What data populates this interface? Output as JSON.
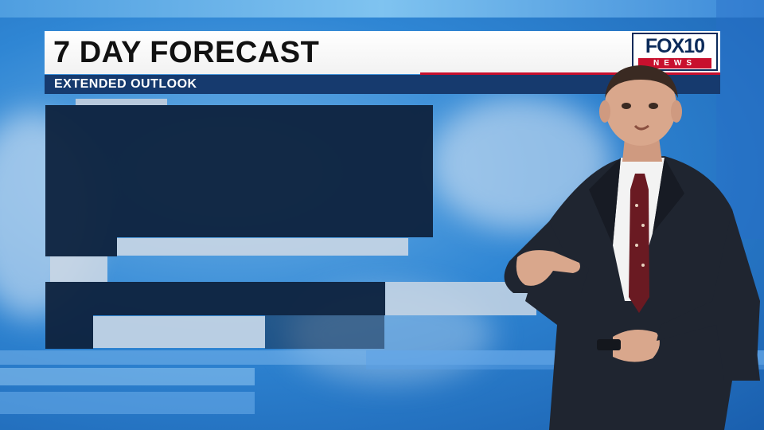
{
  "header": {
    "title": "7 DAY FORECAST",
    "subtitle": "EXTENDED OUTLOOK"
  },
  "logo": {
    "main": "FOX10",
    "sub": "NEWS"
  },
  "colors": {
    "background_blue": "#2f86d4",
    "title_bar": "#ffffff",
    "subtitle_bar": "#163a6e",
    "accent_red": "#c8102e",
    "forecast_panel_dark": "#0f2340",
    "forecast_panel_light": "#c9d6e4"
  },
  "presenter": {
    "suit_color": "#1f2530",
    "tie_color": "#6a1a22"
  }
}
